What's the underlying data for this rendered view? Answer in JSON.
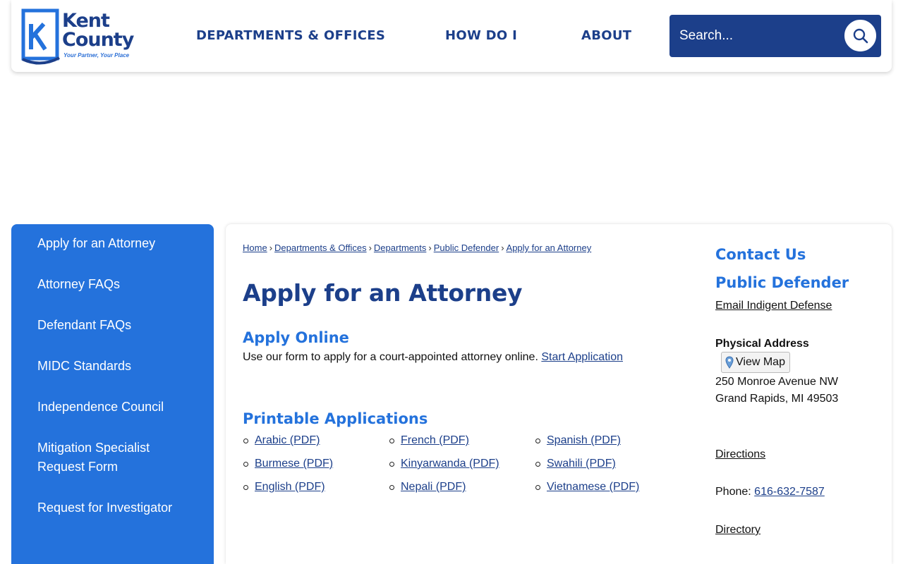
{
  "brand": {
    "name_line1": "Kent",
    "name_line2": "County",
    "tagline": "Your Partner, Your Place",
    "primary_color": "#1c3f8a",
    "accent_color": "#2472dc"
  },
  "nav": {
    "items": [
      "DEPARTMENTS & OFFICES",
      "HOW DO I",
      "ABOUT"
    ]
  },
  "search": {
    "placeholder": "Search...",
    "button_icon": "search-icon"
  },
  "sidebar": {
    "items": [
      {
        "label": "Apply for an Attorney"
      },
      {
        "label": "Attorney FAQs"
      },
      {
        "label": "Defendant FAQs"
      },
      {
        "label": "MIDC Standards"
      },
      {
        "label": "Independence Council"
      },
      {
        "label": "Mitigation Specialist Request Form"
      },
      {
        "label": "Request for Investigator"
      }
    ]
  },
  "breadcrumb": [
    "Home",
    "Departments & Offices",
    "Departments",
    "Public Defender",
    "Apply for an Attorney"
  ],
  "main": {
    "title": "Apply for an Attorney",
    "apply_online": {
      "heading": "Apply Online",
      "text": "Use our form to apply for a court-appointed attorney online.",
      "link": "Start Application"
    },
    "printable": {
      "heading": "Printable Applications",
      "columns": [
        [
          "Arabic (PDF)",
          "Burmese (PDF)",
          "English (PDF)"
        ],
        [
          "French (PDF)",
          "Kinyarwanda (PDF)",
          "Nepali (PDF)"
        ],
        [
          "Spanish (PDF)",
          "Swahili (PDF)",
          "Vietnamese (PDF)"
        ]
      ]
    }
  },
  "contact": {
    "heading": "Contact Us",
    "dept": "Public Defender",
    "email_link": "Email Indigent Defense",
    "address_label": "Physical Address",
    "map_button": "View Map",
    "map_icon": "map-pin-icon",
    "address_line1": "250 Monroe Avenue NW",
    "address_line2": "Grand Rapids, MI 49503",
    "directions": "Directions",
    "phone_label": "Phone:",
    "phone": "616-632-7587",
    "directory": "Directory"
  }
}
